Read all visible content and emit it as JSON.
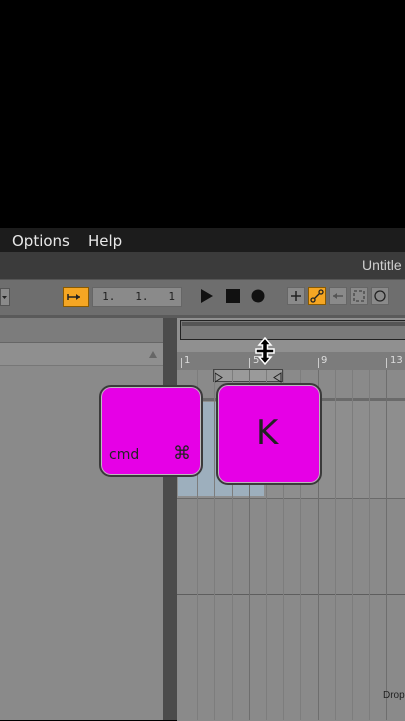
{
  "menu": {
    "options": "Options",
    "help": "Help"
  },
  "window": {
    "title": "Untitle"
  },
  "transport": {
    "position": "1.   1.   1",
    "accent_color": "#f5a623"
  },
  "ruler": {
    "ticks": [
      "1",
      "5",
      "9",
      "13"
    ]
  },
  "keys": {
    "modifier_label": "cmd",
    "modifier_symbol": "⌘",
    "letter": "K",
    "color": "#e600e6"
  },
  "drop_hint": "Drop",
  "icons": [
    "menu-dropdown-icon",
    "follow-icon",
    "play-icon",
    "stop-icon",
    "record-icon",
    "add-icon",
    "link-icon",
    "back-icon",
    "fullscreen-icon",
    "circle-icon",
    "resize-cursor-icon"
  ]
}
